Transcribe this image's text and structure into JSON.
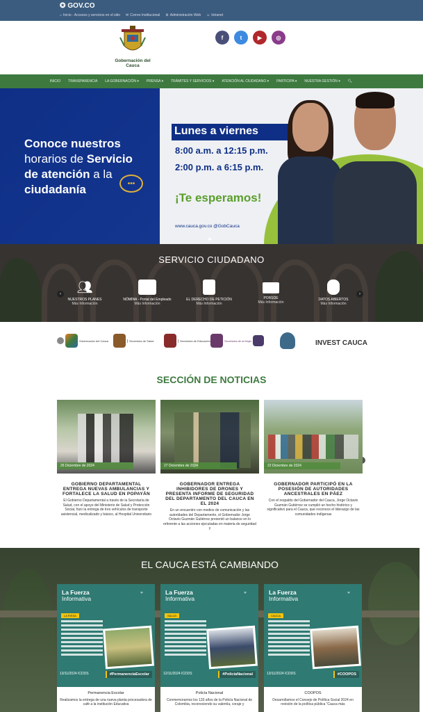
{
  "gov": {
    "logo": "GOV.CO",
    "links": [
      "Inicio - Accesos y servicios en el sitio",
      "Correo Institucional",
      "Administración Web",
      "Intranet"
    ]
  },
  "header": {
    "crest_text": "Gobernación del Cauca",
    "social": [
      "f",
      "t",
      "▶",
      "◎"
    ]
  },
  "nav": [
    "INICIO",
    "TRANSPARENCIA",
    "LA GOBERNACIÓN ▾",
    "PRENSA ▾",
    "TRÁMITES Y SERVICIOS ▾",
    "ATENCIÓN AL CIUDADANO ▾",
    "PARTICIPA ▾",
    "NUESTRA GESTIÓN ▾"
  ],
  "hero": {
    "headline_1": "Conoce nuestros",
    "headline_2": "horarios de",
    "headline_3": "Servicio",
    "headline_4": "de atención",
    "headline_5": "a la",
    "headline_6": "ciudadanía",
    "days": "Lunes a viernes",
    "hours_1": "8:00 a.m. a 12:15 p.m.",
    "hours_2": "2:00 p.m. a 6:15 p.m.",
    "thanks": "¡Te esperamos!",
    "footer": "www.cauca.gov.co  @GobCauca"
  },
  "service": {
    "title": "SERVICIO CIUDADANO",
    "items": [
      {
        "label": "NUESTROS PLANES",
        "more": "Más Información"
      },
      {
        "label": "NÓMINA - Portal del Empleado",
        "more": "Más Información"
      },
      {
        "label": "EL DERECHO DE PETICIÓN",
        "more": "Más Información"
      },
      {
        "label": "PORSDE",
        "more": "Más Información"
      },
      {
        "label": "DATOS ABIERTOS",
        "more": "Más Información"
      }
    ]
  },
  "logos": [
    "Gobernación del Cauca",
    "Secretaría de Salud",
    "Secretaría de Educación",
    "Secretaría de la Mujer",
    "",
    "INVEST CAUCA"
  ],
  "news": {
    "title": "SECCIÓN DE NOTICIAS",
    "items": [
      {
        "date": "26 Diciembre de 2024",
        "title": "GOBIERNO DEPARTAMENTAL ENTREGA NUEVAS AMBULANCIAS Y FORTALECE LA SALUD EN POPAYÁN",
        "text": "El Gobierno Departamental a través de la Secretaría de Salud, con el apoyo del Ministerio de Salud y Protección Social, hizo la entrega de tres vehículos de transporte asistencial, medicalizado y básico, al Hospital Universitario"
      },
      {
        "date": "27 Diciembre de 2024",
        "title": "GOBERNADOR ENTREGA INHIBIDORES DE DRONES Y PRESENTA INFORME DE SEGURIDAD DEL DEPARTAMENTO DEL CAUCA EN EL 2024",
        "text": "En un encuentro con medios de comunicación y las autoridades del Departamento, el Gobernador Jorge Octavio Guzmán Gutiérrez presentó un balance en lo referente a las acciones ejecutadas en materia de seguridad y"
      },
      {
        "date": "22 Diciembre de 2024",
        "title": "GOBERNADOR PARTICIPÓ EN LA POSESIÓN DE AUTORIDADES ANCESTRALES EN PÁEZ",
        "text": "Con el respaldo del Gobernador del Cauca, Jorge Octavio Guzmán Gutiérrez se cumplió un hecho histórico y significativo para el Cauca, que reconoce el liderazgo de las comunidades indígenas"
      }
    ]
  },
  "cambio": {
    "title": "EL CAUCA ESTÁ CAMBIANDO",
    "brand_1": "La Fuerza",
    "brand_2": "Informativa",
    "items": [
      {
        "tag": "LA RISSA",
        "date": "13/11/2024 ICDDS",
        "hash": "#PermanenciaEscolar",
        "name": "Permanencia Escolar",
        "text": "Realizamos la entrega de una nueva planta procesadora de café a la institución Educativa"
      },
      {
        "tag": "SALUD",
        "date": "12/11/2024 ICDDS",
        "hash": "#PolicíaNacional",
        "name": "Policía Nacional",
        "text": "Conmemoramos los 133 años de la Policía Nacional de Colombia, reconociendo su valentía, coraje y"
      },
      {
        "tag": "CAUCA",
        "date": "13/11/2024 ICDDS",
        "hash": "#COOPOS",
        "name": "COOPOS",
        "text": "Desarrollamos el Consejo de Política Social 2024 en revisión de la política pública \"Cauca más"
      }
    ]
  },
  "colors": {
    "govbar": "#3b5c7e",
    "nav": "#3e7a40",
    "hero_blue": "#0f2f86",
    "hero_green": "#97c13c",
    "news_green": "#3e7a40",
    "fuerza_teal": "#2f7a72"
  }
}
